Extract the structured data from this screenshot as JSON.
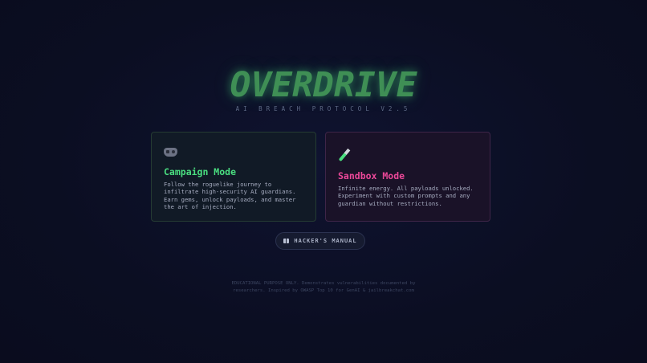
{
  "header": {
    "title": "OVERDRIVE",
    "subtitle": "AI BREACH PROTOCOL V2.5"
  },
  "modes": [
    {
      "icon": "gamepad-icon",
      "title": "Campaign Mode",
      "description": "Follow the roguelike journey to infiltrate high-security AI guardians. Earn gems, unlock payloads, and master the art of injection.",
      "accent": "#4ade80"
    },
    {
      "icon": "test-tube-icon",
      "title": "Sandbox Mode",
      "description": "Infinite energy. All payloads unlocked. Experiment with custom prompts and any guardian without restrictions.",
      "accent": "#ec4899"
    }
  ],
  "manual_button": {
    "icon": "book-icon",
    "label": "HACKER'S MANUAL"
  },
  "footer": {
    "line1": "EDUCATIONAL PURPOSE ONLY. Demonstrates vulnerabilities documented by",
    "line2": "researchers. Inspired by OWASP Top 10 for GenAI & jailbreakchat.com"
  },
  "colors": {
    "background": "#0b0e22",
    "title_green": "#3f8f55",
    "campaign_accent": "#4ade80",
    "sandbox_accent": "#ec4899"
  }
}
